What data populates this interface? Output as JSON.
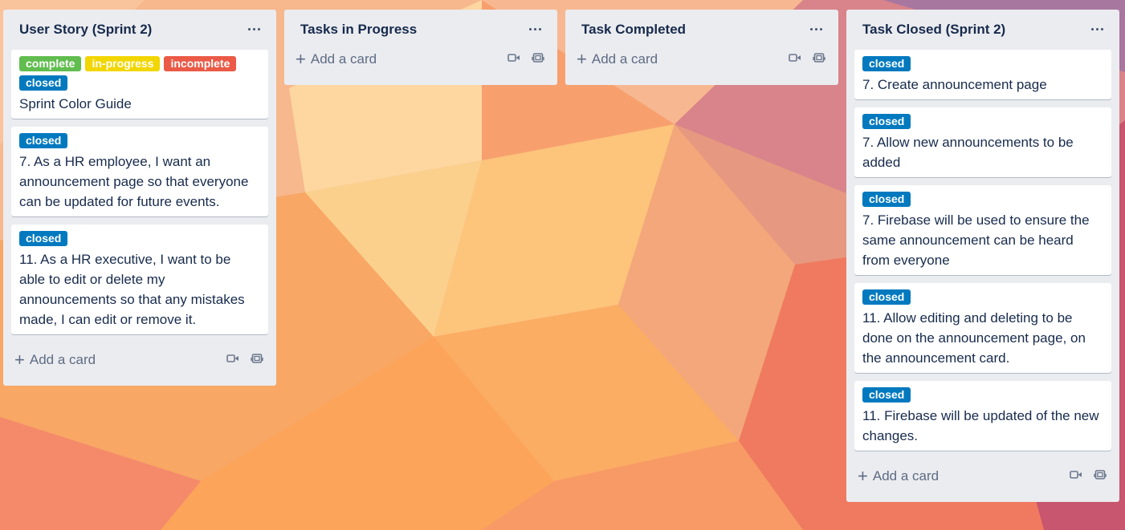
{
  "colors": {
    "complete": "#61bd4f",
    "in_progress": "#f2d600",
    "incomplete": "#eb5a46",
    "closed": "#0079bf",
    "list_bg": "#ebecf0"
  },
  "lists": [
    {
      "title": "User Story (Sprint 2)",
      "cards": [
        {
          "labels": [
            {
              "text": "complete",
              "color": "#61bd4f"
            },
            {
              "text": "in-progress",
              "color": "#f2d600"
            },
            {
              "text": "incomplete",
              "color": "#eb5a46"
            },
            {
              "text": "closed",
              "color": "#0079bf"
            }
          ],
          "title": "Sprint Color Guide"
        },
        {
          "labels": [
            {
              "text": "closed",
              "color": "#0079bf"
            }
          ],
          "title": "7. As a HR employee, I want an announcement page so that everyone can be updated for future events."
        },
        {
          "labels": [
            {
              "text": "closed",
              "color": "#0079bf"
            }
          ],
          "title": "11. As a HR executive, I want to be able to edit or delete my announcements so that any mistakes made, I can edit or remove it."
        }
      ],
      "add_card_label": "Add a card"
    },
    {
      "title": "Tasks in Progress",
      "cards": [],
      "add_card_label": "Add a card"
    },
    {
      "title": "Task Completed",
      "cards": [],
      "add_card_label": "Add a card"
    },
    {
      "title": "Task Closed (Sprint 2)",
      "cards": [
        {
          "labels": [
            {
              "text": "closed",
              "color": "#0079bf"
            }
          ],
          "title": "7. Create announcement page"
        },
        {
          "labels": [
            {
              "text": "closed",
              "color": "#0079bf"
            }
          ],
          "title": "7. Allow new announcements to be added"
        },
        {
          "labels": [
            {
              "text": "closed",
              "color": "#0079bf"
            }
          ],
          "title": "7. Firebase will be used to ensure the same announcement can be heard from everyone"
        },
        {
          "labels": [
            {
              "text": "closed",
              "color": "#0079bf"
            }
          ],
          "title": "11. Allow editing and deleting to be done on the announcement page, on the announcement card."
        },
        {
          "labels": [
            {
              "text": "closed",
              "color": "#0079bf"
            }
          ],
          "title": "11. Firebase will be updated of the new changes."
        }
      ],
      "add_card_label": "Add a card"
    }
  ],
  "icons": {
    "list_menu": "more-horizontal-icon",
    "add_card": "plus-icon",
    "template_a": "video-camera-icon",
    "template_b": "card-template-icon"
  }
}
